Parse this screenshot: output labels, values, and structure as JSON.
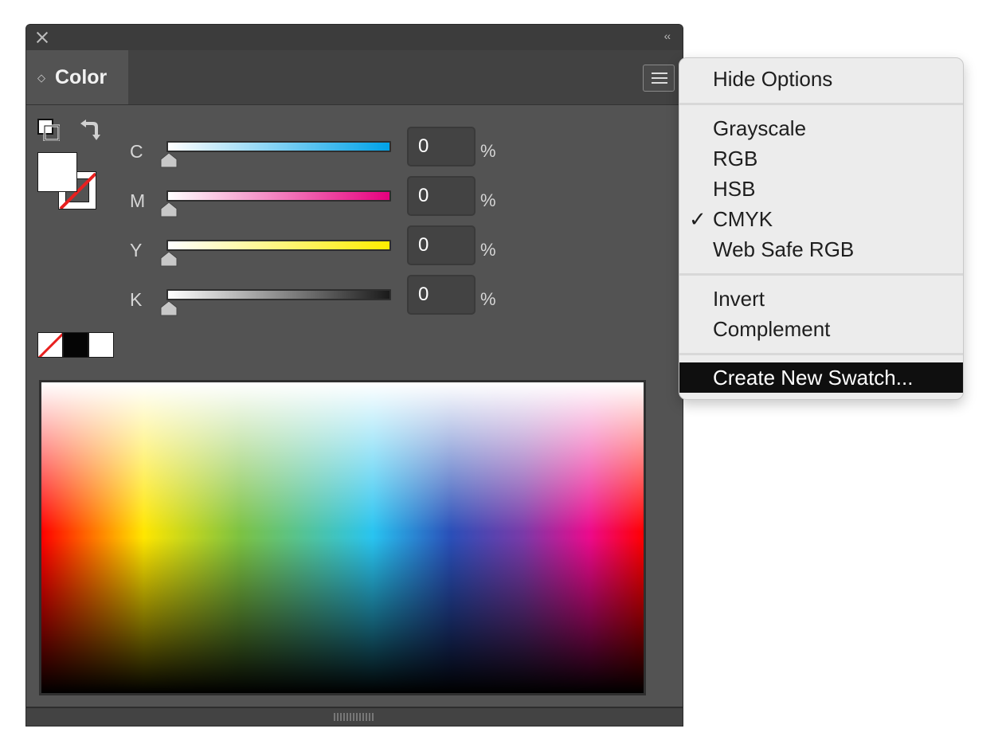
{
  "panel": {
    "tab_title": "Color",
    "tab_arrows": "◇",
    "collapse_glyph": "‹‹",
    "sliders": [
      {
        "label": "C",
        "value": "0",
        "unit": "%",
        "gradient_start": "#ffffff",
        "gradient_end": "#00a2e8"
      },
      {
        "label": "M",
        "value": "0",
        "unit": "%",
        "gradient_start": "#ffffff",
        "gradient_end": "#e6007e"
      },
      {
        "label": "Y",
        "value": "0",
        "unit": "%",
        "gradient_start": "#ffffff",
        "gradient_end": "#ffed00"
      },
      {
        "label": "K",
        "value": "0",
        "unit": "%",
        "gradient_start": "#ffffff",
        "gradient_end": "#1a1a1a"
      }
    ],
    "quick_swatches": [
      "none",
      "black",
      "white"
    ],
    "icons": {
      "close": "close-icon",
      "collapse": "double-chevron-left-icon",
      "menu": "hamburger-menu-icon",
      "default_fill_stroke": "default-fill-stroke-icon",
      "swap": "swap-fill-stroke-icon"
    }
  },
  "menu": {
    "items_group1": [
      {
        "label": "Hide Options"
      }
    ],
    "items_group2": [
      {
        "label": "Grayscale",
        "checked": false
      },
      {
        "label": "RGB",
        "checked": false
      },
      {
        "label": "HSB",
        "checked": false
      },
      {
        "label": "CMYK",
        "checked": true
      },
      {
        "label": "Web Safe RGB",
        "checked": false
      }
    ],
    "items_group3": [
      {
        "label": "Invert"
      },
      {
        "label": "Complement"
      }
    ],
    "items_group4": [
      {
        "label": "Create New Swatch...",
        "highlighted": true
      }
    ],
    "check_glyph": "✓"
  },
  "colors": {
    "panel_bg": "#535353",
    "highlight": "#0f0f0f",
    "none_slash": "#e8201f"
  }
}
